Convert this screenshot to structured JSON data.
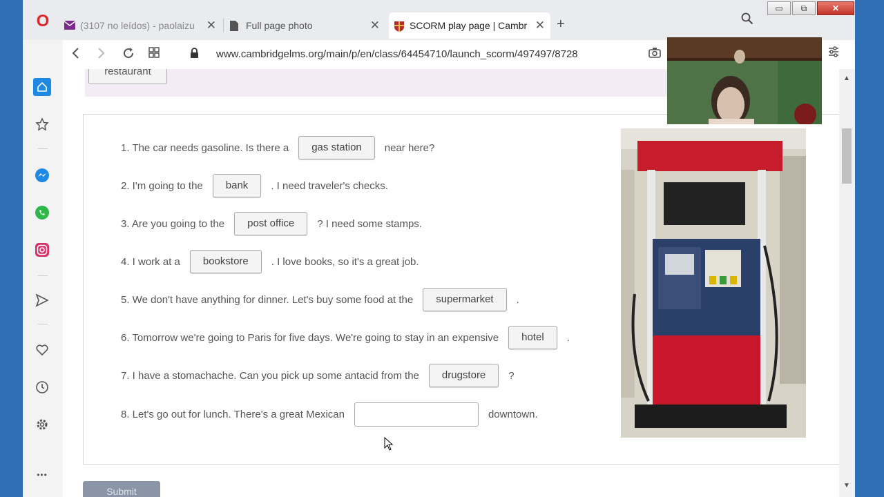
{
  "browser": {
    "logo_glyph": "O",
    "tabs": [
      {
        "title": "(3107 no leídos) - paolaizu",
        "icon": "mail-icon",
        "active": false
      },
      {
        "title": "Full page photo",
        "icon": "document-icon",
        "active": false
      },
      {
        "title": "SCORM play page | Cambr",
        "icon": "cambridge-shield-icon",
        "active": true
      }
    ],
    "new_tab_glyph": "+",
    "close_glyph": "✕",
    "url": "www.cambridgelms.org/main/p/en/class/64454710/launch_scorm/497497/8728",
    "window_controls": {
      "minimize": "▭",
      "maximize": "⧉",
      "close": "✕"
    }
  },
  "sidebar": {
    "items": [
      "home-icon",
      "speed-dial-icon",
      "messenger-icon",
      "whatsapp-icon",
      "instagram-icon",
      "send-icon",
      "heart-icon",
      "history-icon",
      "settings-icon",
      "more-icon"
    ],
    "more_glyph": "•••"
  },
  "exercise": {
    "previous_chip": "restaurant",
    "questions": [
      {
        "before": "1. The car needs gasoline. Is there a",
        "answer": "gas station",
        "after": "near here?"
      },
      {
        "before": "2. I'm going to the",
        "answer": "bank",
        "after": ". I need traveler's checks."
      },
      {
        "before": "3. Are you going to the",
        "answer": "post office",
        "after": "? I need some stamps."
      },
      {
        "before": "4. I work at a",
        "answer": "bookstore",
        "after": ". I love books, so it's a great job."
      },
      {
        "before": "5. We don't have anything for dinner. Let's buy some food at the",
        "answer": "supermarket",
        "after": "."
      },
      {
        "before": "6. Tomorrow we're going to Paris for five days. We're going to stay in an expensive",
        "answer": "hotel",
        "after": "."
      },
      {
        "before": "7. I have a stomachache. Can you pick up some antacid from the",
        "answer": "drugstore",
        "after": "?"
      },
      {
        "before": "8. Let's go out for lunch. There's a great Mexican",
        "answer": "",
        "after": "downtown."
      }
    ],
    "submit_label": "Submit"
  },
  "colors": {
    "accent": "#e0262b",
    "home_blue": "#1e88e5",
    "pump_red": "#c8162a",
    "pump_blue": "#2a3f6a"
  }
}
